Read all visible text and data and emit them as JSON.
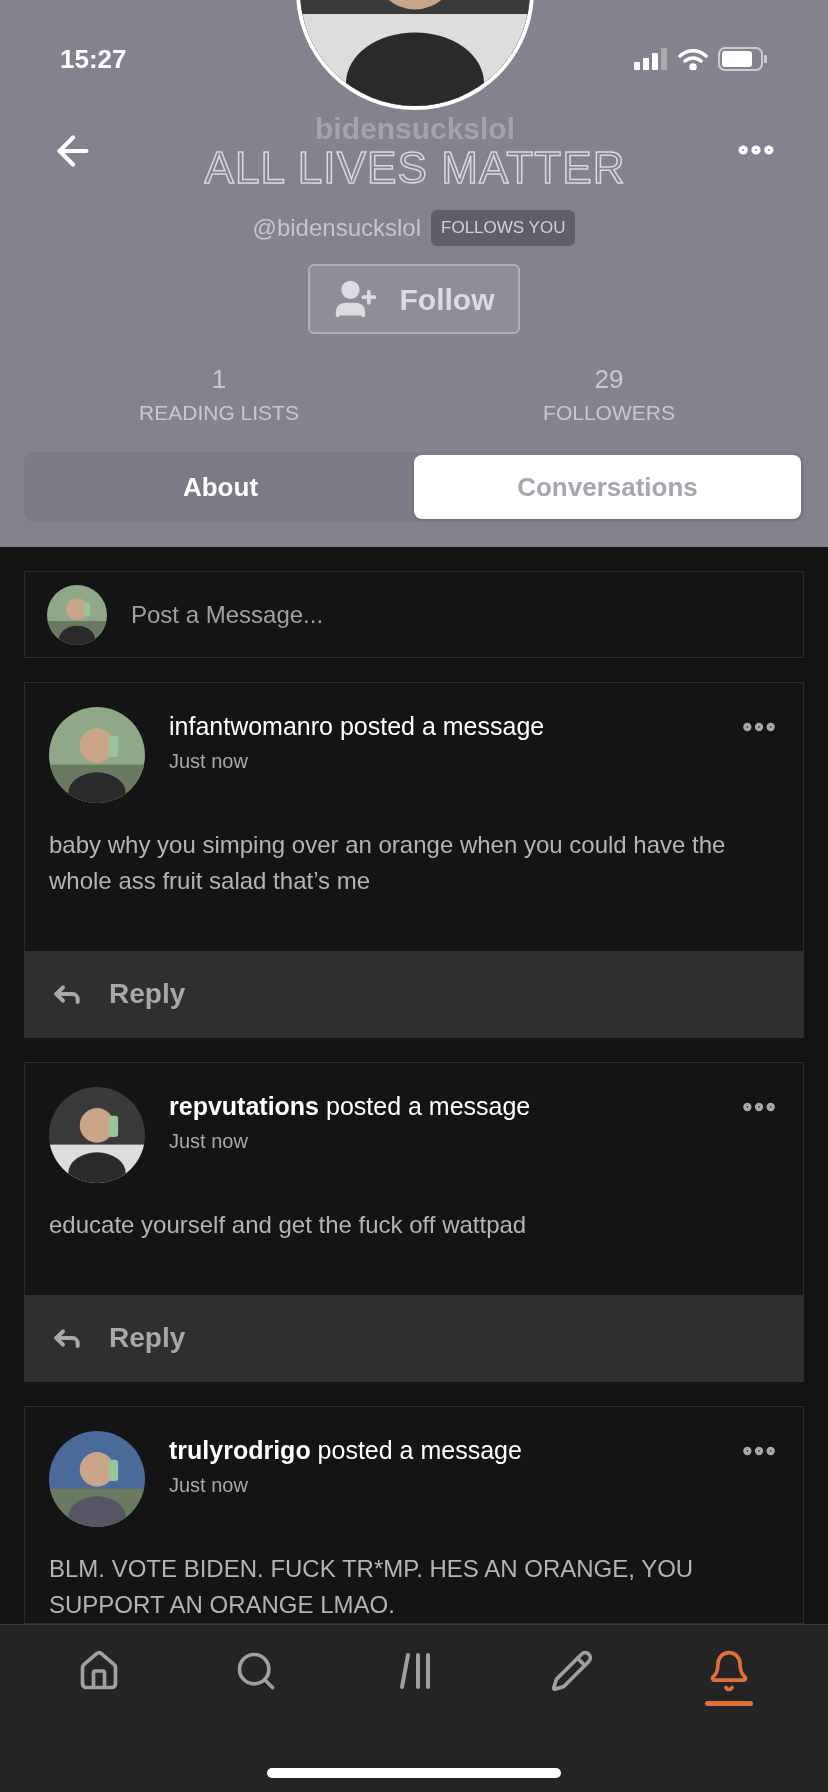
{
  "status_bar": {
    "time": "15:27"
  },
  "profile": {
    "display_name": "bidensuckslol",
    "banner_text": "ALL LIVES MATTER",
    "handle": "@bidensuckslol",
    "follows_you_badge": "FOLLOWS YOU",
    "follow_button": "Follow",
    "stats": [
      {
        "value": "1",
        "label": "READING LISTS"
      },
      {
        "value": "29",
        "label": "FOLLOWERS"
      }
    ]
  },
  "tabs": [
    {
      "label": "About",
      "selected": false
    },
    {
      "label": "Conversations",
      "selected": true
    }
  ],
  "composer": {
    "placeholder": "Post a Message..."
  },
  "posts": [
    {
      "header": "infantwomanro posted a message",
      "time": "Just now",
      "body": "baby why you simping over an orange when you could have the whole ass fruit salad that’s me",
      "reply": "Reply"
    },
    {
      "header": "**repvutations** posted a message",
      "time": "Just now",
      "body": "educate yourself and get the fuck off wattpad",
      "reply": "Reply"
    },
    {
      "header": "**trulyrodrigo** posted a message",
      "time": "Just now",
      "body": "BLM. VOTE BIDEN. FUCK TR*MP. HES AN ORANGE, YOU SUPPORT AN ORANGE LMAO."
    }
  ],
  "nav": [
    {
      "kind": "home",
      "selected": false
    },
    {
      "kind": "search",
      "selected": false
    },
    {
      "kind": "library",
      "selected": false
    },
    {
      "kind": "write",
      "selected": false
    },
    {
      "kind": "notifications",
      "selected": true
    }
  ]
}
